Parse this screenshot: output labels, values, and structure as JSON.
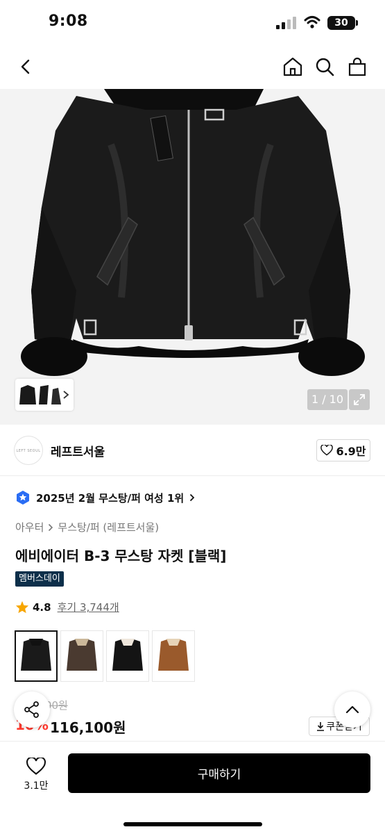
{
  "status_bar": {
    "time": "9:08",
    "battery": "30"
  },
  "nav": {
    "back_icon": "chevron-left-icon",
    "home_icon": "home-icon",
    "search_icon": "search-icon",
    "cart_icon": "shopping-bag-icon"
  },
  "gallery": {
    "page_counter": "1 / 10",
    "current_page": 1,
    "total_pages": 10
  },
  "brand": {
    "logo_text": "LEFT SEOUL",
    "name": "레프트서울",
    "likes": "6.9만"
  },
  "ranking": {
    "text": "2025년 2월 무스탕/퍼 여성 1위"
  },
  "breadcrumb": {
    "category": "아우터",
    "subcategory": "무스탕/퍼 (레프트서울)"
  },
  "product": {
    "title": "에비에이터 B-3 무스탕 자켓 [블랙]",
    "badge": "멤버스데이",
    "rating": "4.8",
    "reviews": "후기 3,744개"
  },
  "color_options": [
    {
      "name": "black",
      "color": "#1a1a1a",
      "collar": "#111111"
    },
    {
      "name": "dark-brown",
      "color": "#4a3a30",
      "collar": "#cbb89a"
    },
    {
      "name": "black-ivory",
      "color": "#141414",
      "collar": "#efe7dc"
    },
    {
      "name": "camel",
      "color": "#9a5a2c",
      "collar": "#e6d3b8"
    }
  ],
  "price": {
    "original": "129,000원",
    "discount": "10%",
    "sale": "116,100원",
    "coupon_label": "쿠폰받기"
  },
  "bottom_bar": {
    "wish_count": "3.1만",
    "buy_label": "구매하기"
  },
  "colors": {
    "accent": "#ff3b30",
    "badge_bg": "#0d2f4a",
    "buy_bg": "#000000"
  }
}
